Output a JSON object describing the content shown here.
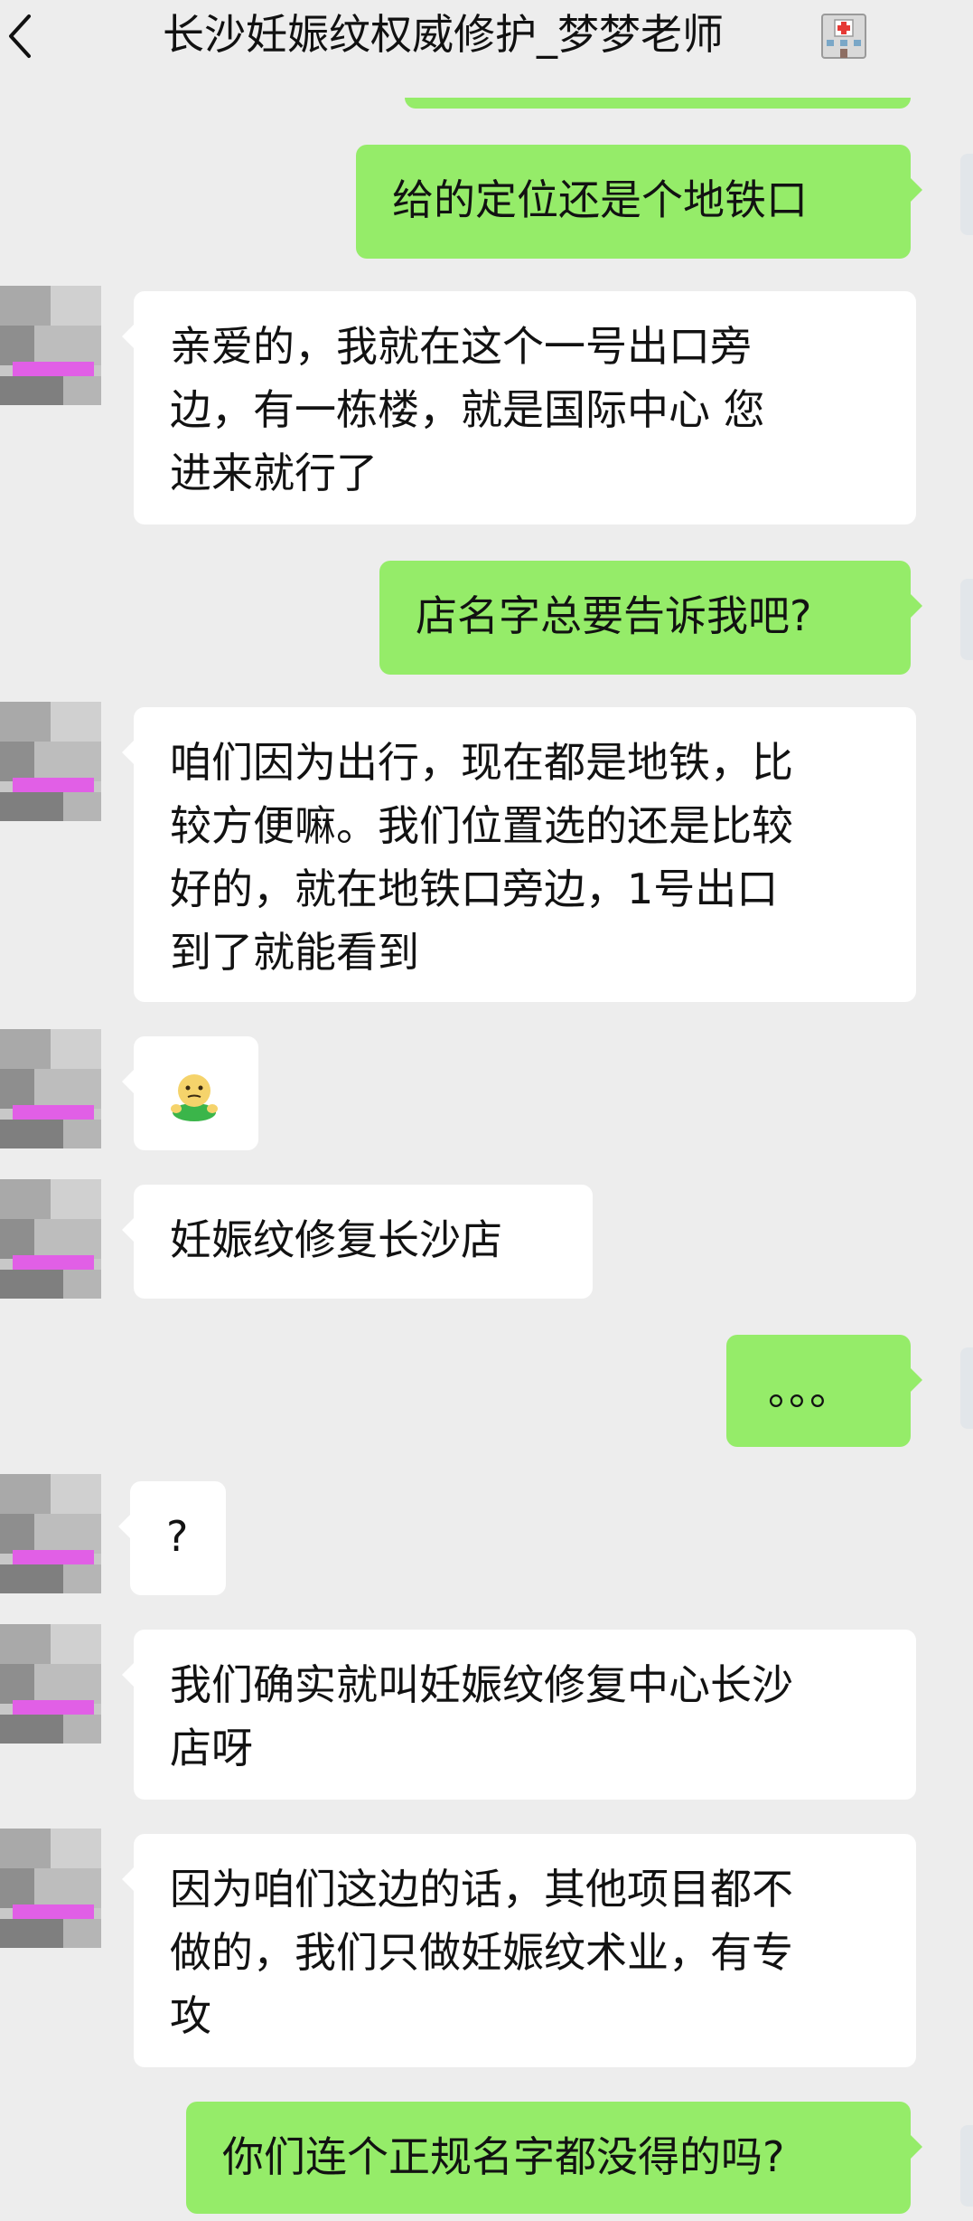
{
  "header": {
    "title": "长沙妊娠纹权威修护_梦梦老师",
    "back_icon": "chevron-left-icon",
    "title_emoji": "hospital-icon"
  },
  "colors": {
    "background": "#ededed",
    "sent_bubble": "#95ec69",
    "received_bubble": "#ffffff",
    "text": "#121212"
  },
  "messages": [
    {
      "side": "right",
      "lines": [
        "给的定位还是个地铁口"
      ]
    },
    {
      "side": "left",
      "lines": [
        "亲爱的，我就在这个一号出口旁",
        "边，有一栋楼，就是国际中心 您",
        "进来就行了"
      ]
    },
    {
      "side": "right",
      "lines": [
        "店名字总要告诉我吧?"
      ]
    },
    {
      "side": "left",
      "lines": [
        "咱们因为出行，现在都是地铁，比",
        "较方便嘛。我们位置选的还是比较",
        "好的，就在地铁口旁边，1号出口",
        "到了就能看到"
      ]
    },
    {
      "side": "left",
      "type": "emoji",
      "emoji": "awkward-face-emoji"
    },
    {
      "side": "left",
      "lines": [
        "妊娠纹修复长沙店"
      ]
    },
    {
      "side": "right",
      "lines": [
        "。。。"
      ]
    },
    {
      "side": "left",
      "lines": [
        "?"
      ]
    },
    {
      "side": "left",
      "lines": [
        "我们确实就叫妊娠纹修复中心长沙",
        "店呀"
      ]
    },
    {
      "side": "left",
      "lines": [
        "因为咱们这边的话，其他项目都不",
        "做的，我们只做妊娠纹术业，有专",
        "攻"
      ]
    },
    {
      "side": "right",
      "lines": [
        "你们连个正规名字都没得的吗?"
      ]
    }
  ]
}
